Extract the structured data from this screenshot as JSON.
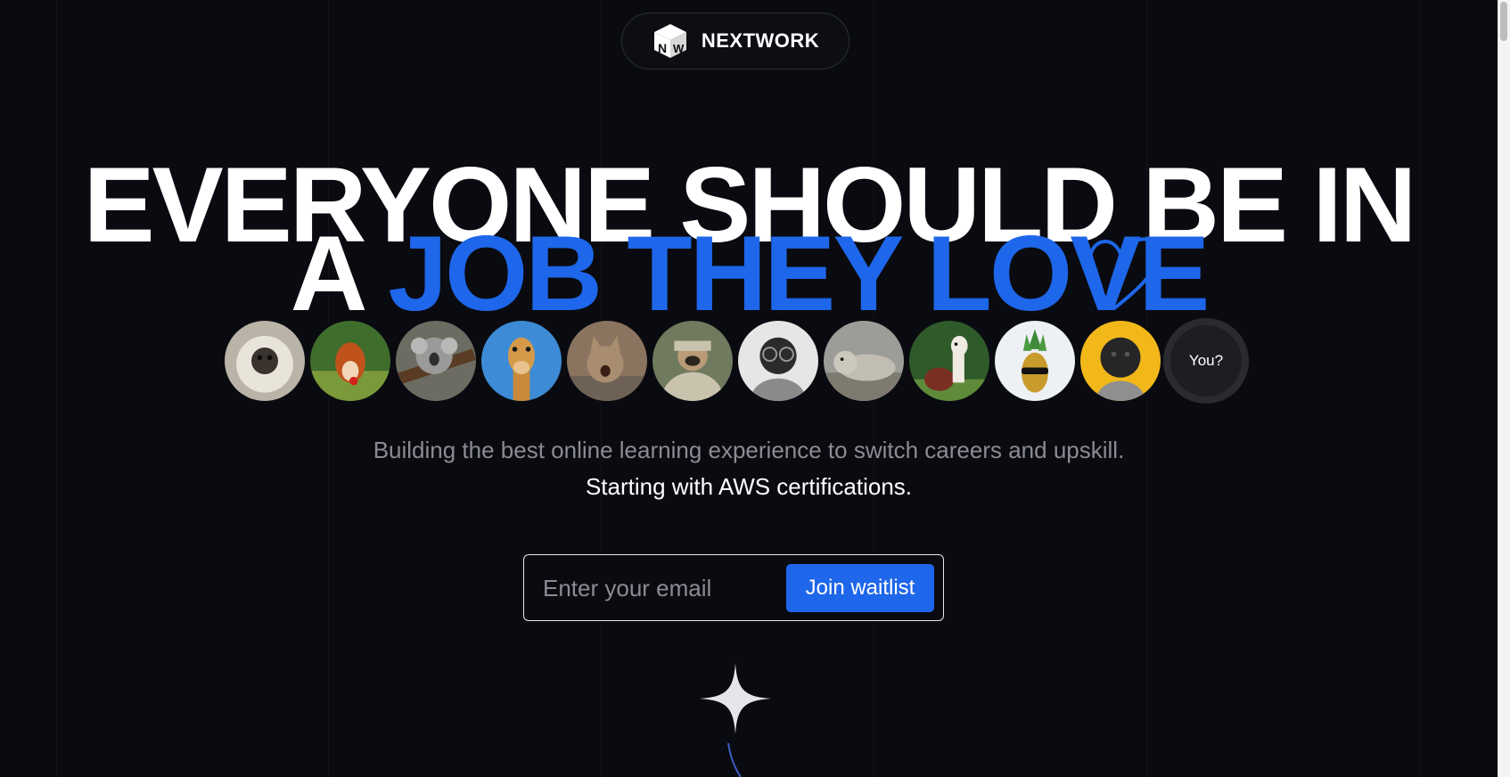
{
  "brand": {
    "name": "NEXTWORK",
    "logo_letters": "NW"
  },
  "headline": {
    "line1": "EVERYONE SHOULD BE IN",
    "line2_prefix": "A ",
    "line2_accent": "JOB THEY LOVE"
  },
  "avatars": {
    "icons": [
      "fluffy-pug-avatar",
      "red-squirrel-avatar",
      "koala-avatar",
      "giraffe-avatar",
      "kitten-avatar",
      "pug-in-blanket-avatar",
      "pug-with-glasses-avatar",
      "seal-avatar",
      "alpaca-avatar",
      "pineapple-sunglasses-avatar",
      "pug-yellow-background-avatar"
    ],
    "placeholder_label": "You?"
  },
  "hero": {
    "subtitle": "Building the best online learning experience to switch careers and upskill.",
    "tagline": "Starting with AWS certifications."
  },
  "waitlist": {
    "email_placeholder": "Enter your email",
    "email_value": "",
    "button_label": "Join waitlist"
  },
  "colors": {
    "background": "#0a0b10",
    "accent": "#1e66ea",
    "muted_text": "#8b8c93"
  }
}
